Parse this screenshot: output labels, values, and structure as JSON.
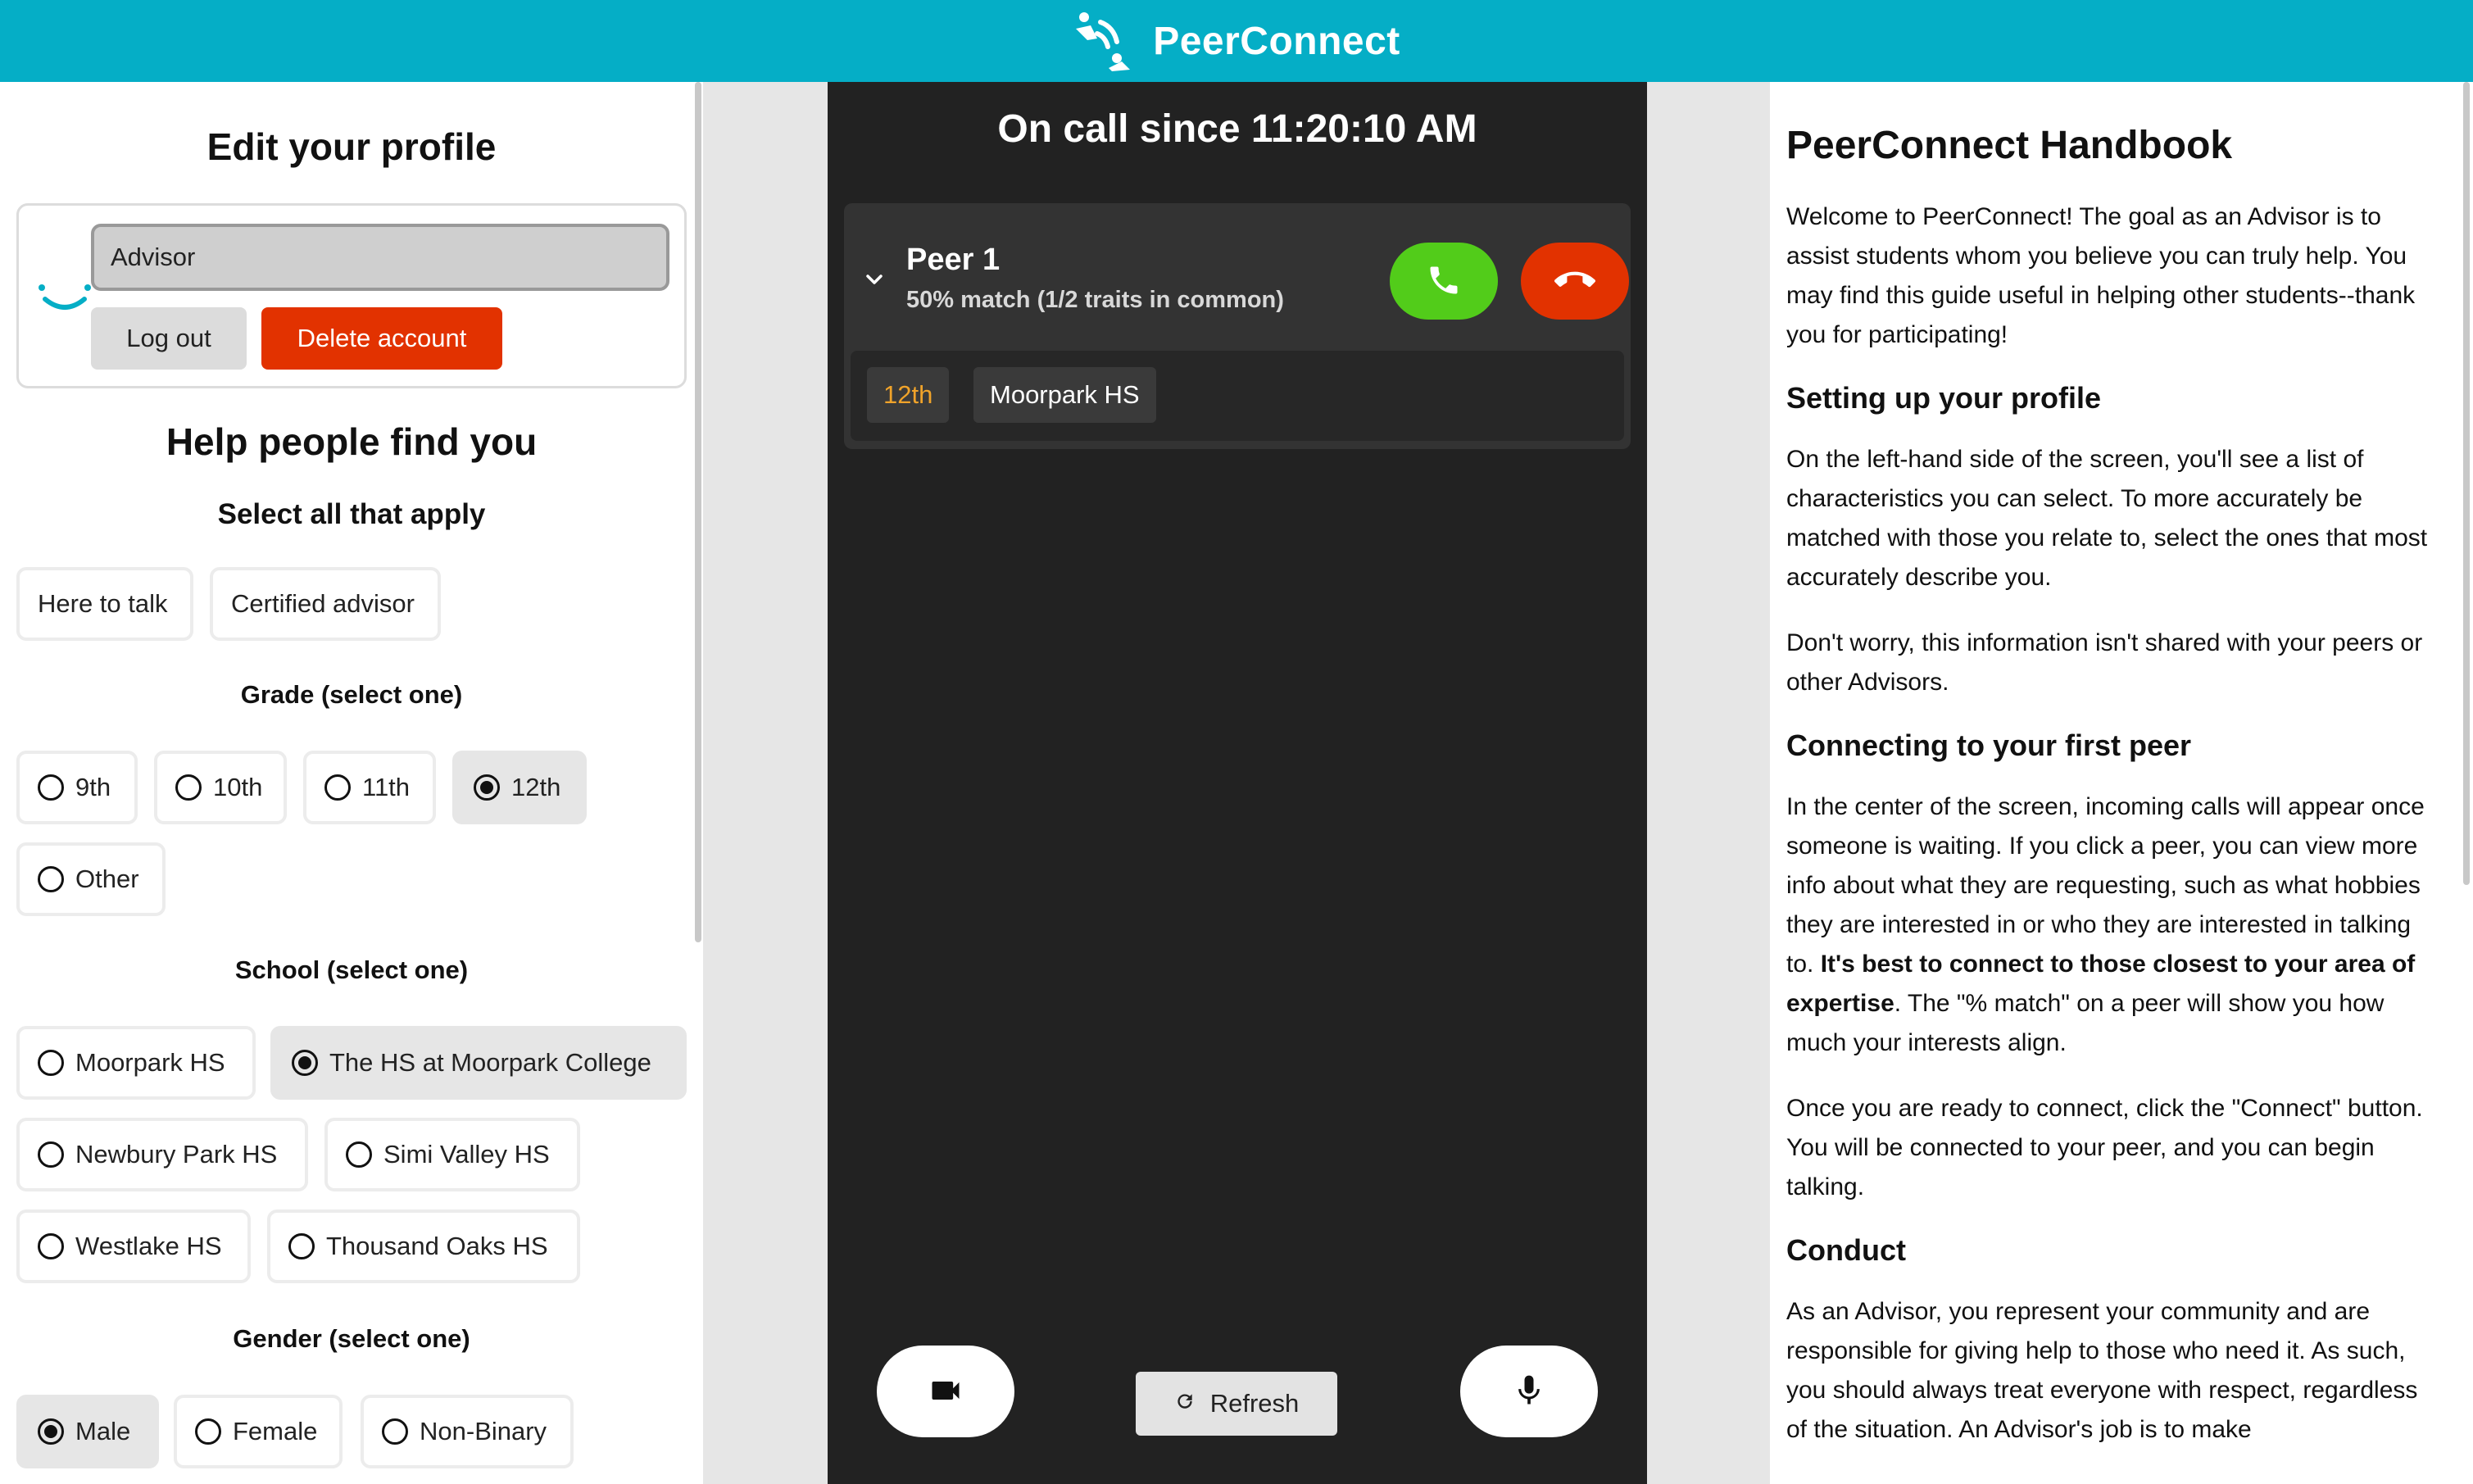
{
  "header": {
    "brand": "PeerConnect",
    "logo_icon": "peerconnect-logo-icon",
    "color": "#05aec6"
  },
  "profile": {
    "title": "Edit your profile",
    "name_value": "Advisor",
    "logout_label": "Log out",
    "delete_label": "Delete account"
  },
  "find": {
    "title": "Help people find you",
    "subtitle": "Select all that apply",
    "roles": [
      "Here to talk",
      "Certified advisor"
    ],
    "grade_title": "Grade (select one)",
    "grades": [
      "9th",
      "10th",
      "11th",
      "12th",
      "Other"
    ],
    "grade_selected": "12th",
    "school_title": "School (select one)",
    "schools": [
      "Moorpark HS",
      "The HS at Moorpark College",
      "Newbury Park HS",
      "Simi Valley HS",
      "Westlake HS",
      "Thousand Oaks HS"
    ],
    "school_selected": "The HS at Moorpark College",
    "gender_title": "Gender (select one)",
    "genders": [
      "Male",
      "Female",
      "Non-Binary"
    ],
    "gender_selected": "Male"
  },
  "call": {
    "title": "On call since 11:20:10 AM",
    "peer": {
      "name": "Peer 1",
      "match": "50% match (1/2 traits in common)",
      "tags": [
        "12th",
        "Moorpark HS"
      ]
    },
    "refresh_label": "Refresh",
    "colors": {
      "accept": "#52cc1a",
      "decline": "#e23200",
      "grade_tag": "#f0a32a"
    }
  },
  "handbook": {
    "title": "PeerConnect Handbook",
    "intro": "Welcome to PeerConnect! The goal as an Advisor is to assist students whom you believe you can truly help. You may find this guide useful in helping other students--thank you for participating!",
    "s1_title": "Setting up your profile",
    "s1_p1": "On the left-hand side of the screen, you'll see a list of characteristics you can select. To more accurately be matched with those you relate to, select the ones that most accurately describe you.",
    "s1_p2": "Don't worry, this information isn't shared with your peers or other Advisors.",
    "s2_title": "Connecting to your first peer",
    "s2_p1_a": "In the center of the screen, incoming calls will appear once someone is waiting. If you click a peer, you can view more info about what they are requesting, such as what hobbies they are interested in or who they are interested in talking to. ",
    "s2_p1_bold": "It's best to connect to those closest to your area of expertise",
    "s2_p1_c": ". The \"% match\" on a peer will show you how much your interests align.",
    "s2_p2": "Once you are ready to connect, click the \"Connect\" button. You will be connected to your peer, and you can begin talking.",
    "s3_title": "Conduct",
    "s3_p1": "As an Advisor, you represent your community and are responsible for giving help to those who need it. As such, you should always treat everyone with respect, regardless of the situation. An Advisor's job is to make"
  }
}
